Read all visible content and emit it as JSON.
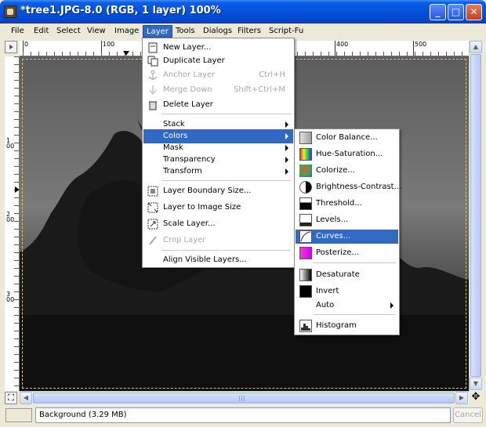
{
  "window": {
    "title": "*tree1.JPG-8.0 (RGB, 1 layer) 100%",
    "minimize_glyph": "_",
    "maximize_glyph": "□",
    "close_glyph": "✕"
  },
  "menubar": {
    "items": [
      "File",
      "Edit",
      "Select",
      "View",
      "Image",
      "Layer",
      "Tools",
      "Dialogs",
      "Filters",
      "Script-Fu"
    ],
    "active": "Layer"
  },
  "ruler": {
    "h_labels": [
      "0",
      "100",
      "400",
      "500"
    ],
    "v_labels": [
      "1",
      "2",
      "3"
    ],
    "v_label_zeros": "00"
  },
  "layer_menu": {
    "items": [
      {
        "label": "New Layer...",
        "icon": "new-layer-icon"
      },
      {
        "label": "Duplicate Layer",
        "icon": "duplicate-layer-icon"
      },
      {
        "label": "Anchor Layer",
        "accel": "Ctrl+H",
        "disabled": true,
        "icon": "anchor-icon"
      },
      {
        "label": "Merge Down",
        "accel": "Shift+Ctrl+M",
        "disabled": true,
        "icon": "merge-down-icon"
      },
      {
        "label": "Delete Layer",
        "icon": "delete-layer-icon"
      },
      {
        "label": "Stack",
        "submenu": true
      },
      {
        "label": "Colors",
        "submenu": true,
        "selected": true
      },
      {
        "label": "Mask",
        "submenu": true
      },
      {
        "label": "Transparency",
        "submenu": true
      },
      {
        "label": "Transform",
        "submenu": true
      },
      {
        "label": "Layer Boundary Size...",
        "icon": "layer-boundary-icon"
      },
      {
        "label": "Layer to Image Size",
        "icon": "layer-to-image-icon"
      },
      {
        "label": "Scale Layer...",
        "icon": "scale-layer-icon"
      },
      {
        "label": "Crop Layer",
        "disabled": true,
        "icon": "crop-icon"
      },
      {
        "label": "Align Visible Layers..."
      }
    ]
  },
  "colors_menu": {
    "items": [
      {
        "label": "Color Balance...",
        "icon": "color-balance-icon"
      },
      {
        "label": "Hue-Saturation...",
        "icon": "hue-saturation-icon"
      },
      {
        "label": "Colorize...",
        "icon": "colorize-icon"
      },
      {
        "label": "Brightness-Contrast...",
        "icon": "brightness-contrast-icon"
      },
      {
        "label": "Threshold...",
        "icon": "threshold-icon"
      },
      {
        "label": "Levels...",
        "icon": "levels-icon"
      },
      {
        "label": "Curves...",
        "icon": "curves-icon",
        "selected": true
      },
      {
        "label": "Posterize...",
        "icon": "posterize-icon"
      },
      {
        "label": "Desaturate",
        "icon": "desaturate-icon"
      },
      {
        "label": "Invert",
        "icon": "invert-icon"
      },
      {
        "label": "Auto",
        "submenu": true
      },
      {
        "label": "Histogram",
        "icon": "histogram-icon"
      }
    ]
  },
  "status": {
    "layer_info": "Background (3.29 MB)",
    "cancel_label": "Cancel"
  },
  "colors": {
    "highlight": "#316ac5",
    "disabled_text": "#a8a8a8",
    "titlebar": "#0352d8"
  }
}
